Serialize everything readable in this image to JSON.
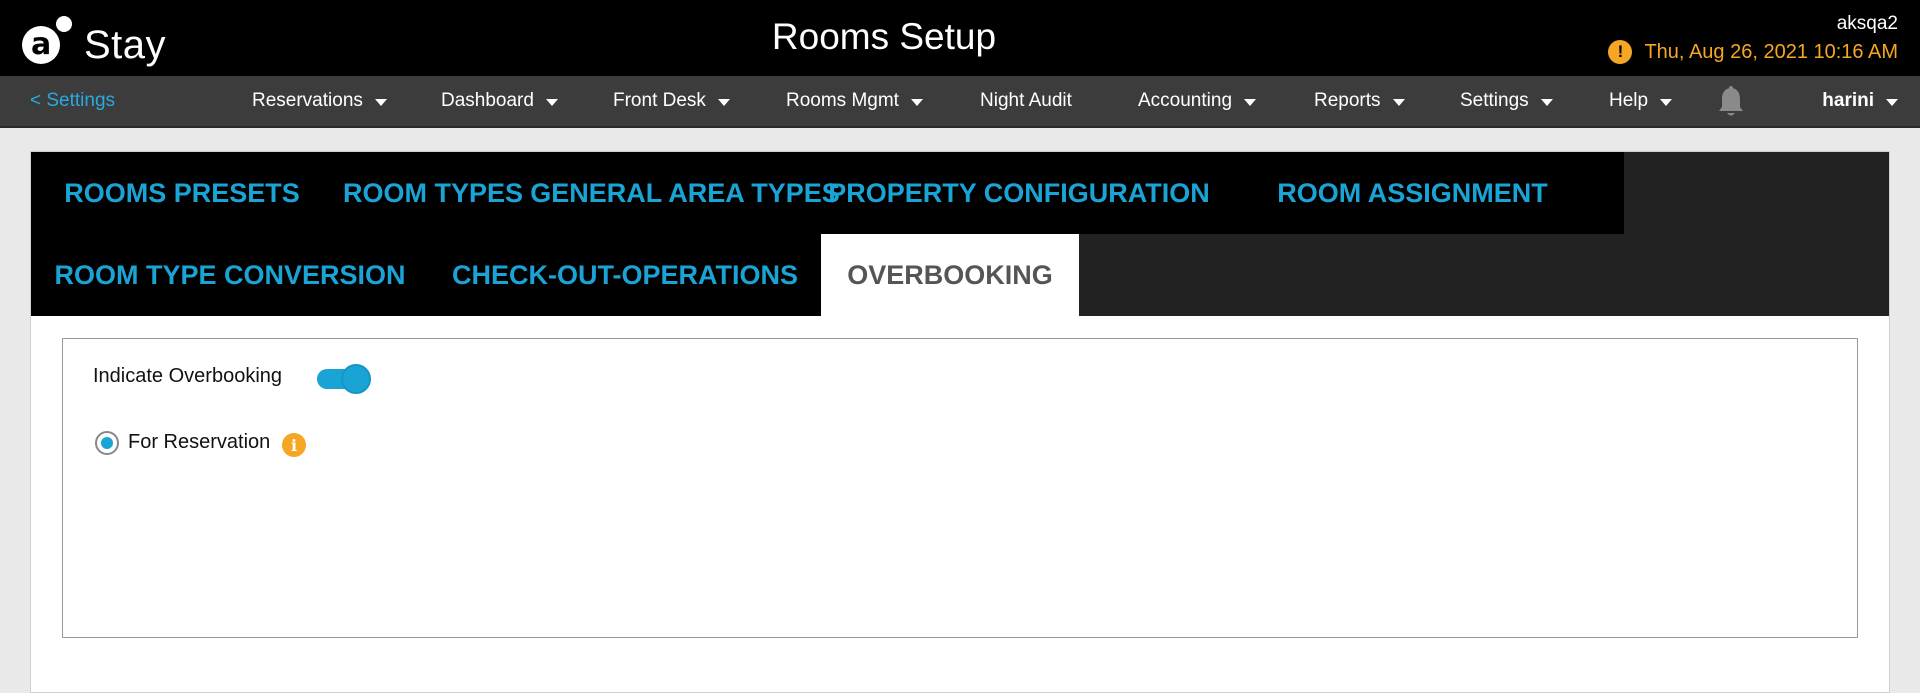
{
  "header": {
    "logo_text": "Stay",
    "logo_letter": "a",
    "title": "Rooms Setup",
    "username": "aksqa2",
    "datetime": "Thu, Aug 26, 2021 10:16 AM",
    "alert_glyph": "!"
  },
  "nav": {
    "back_label": "< Settings",
    "items": [
      {
        "label": "Reservations",
        "has_dropdown": true
      },
      {
        "label": "Dashboard",
        "has_dropdown": true
      },
      {
        "label": "Front Desk",
        "has_dropdown": true
      },
      {
        "label": "Rooms Mgmt",
        "has_dropdown": true
      },
      {
        "label": "Night Audit",
        "has_dropdown": false
      },
      {
        "label": "Accounting",
        "has_dropdown": true
      },
      {
        "label": "Reports",
        "has_dropdown": true
      },
      {
        "label": "Settings",
        "has_dropdown": true
      },
      {
        "label": "Help",
        "has_dropdown": true
      }
    ],
    "user": "harini"
  },
  "tabs": [
    {
      "label": "ROOMS PRESETS",
      "active": false
    },
    {
      "label": "ROOM TYPES",
      "active": false
    },
    {
      "label": "GENERAL AREA TYPES",
      "active": false
    },
    {
      "label": "PROPERTY CONFIGURATION",
      "active": false
    },
    {
      "label": "ROOM ASSIGNMENT",
      "active": false
    },
    {
      "label": "ROOM TYPE CONVERSION",
      "active": false
    },
    {
      "label": "CHECK-OUT-OPERATIONS",
      "active": false
    },
    {
      "label": "OVERBOOKING",
      "active": true
    }
  ],
  "overbooking": {
    "indicate_label": "Indicate Overbooking",
    "indicate_enabled": true,
    "option_label": "For Reservation",
    "option_selected": true,
    "info_glyph": "i"
  },
  "colors": {
    "accent": "#1aa4d6",
    "warning": "#f5a623",
    "header_bg": "#000000",
    "nav_bg": "#3c3c3c"
  }
}
